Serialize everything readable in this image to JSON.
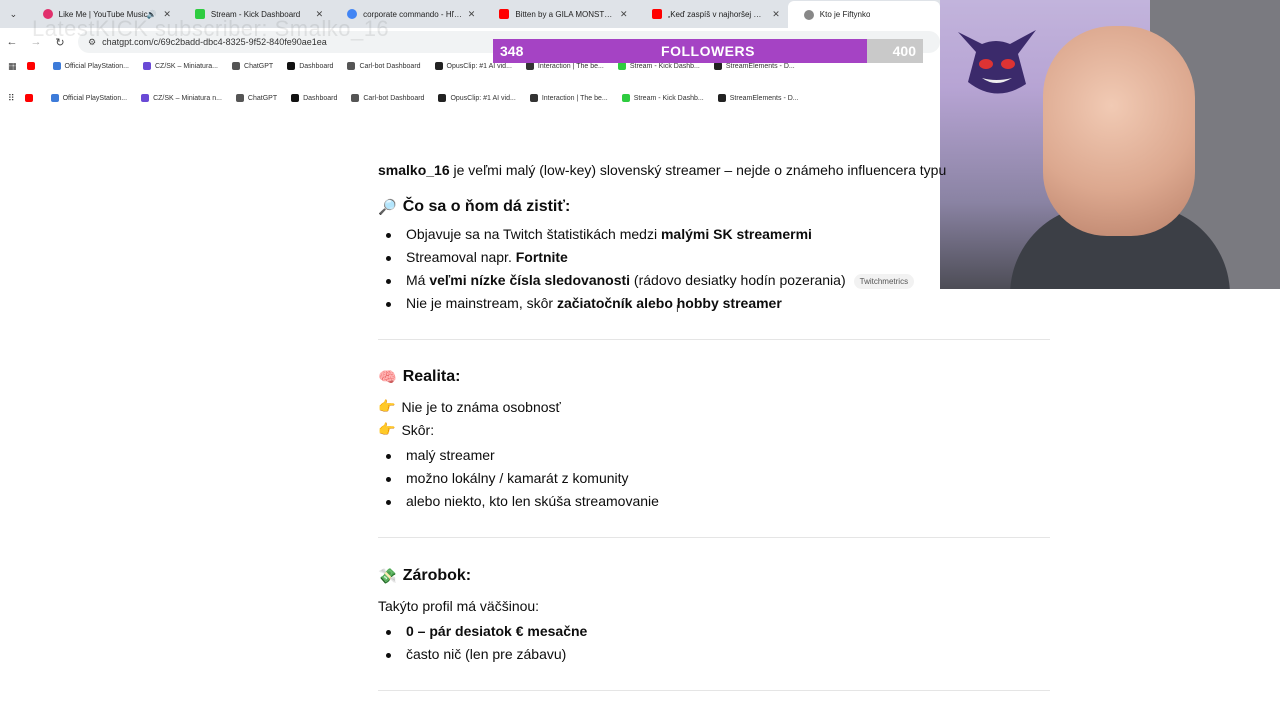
{
  "browser": {
    "tabs": [
      {
        "title": "Like Me | YouTube Music",
        "favicon_color": "#e1306c",
        "muted": true
      },
      {
        "title": "Stream - Kick Dashboard",
        "favicon_color": "#2ecc40"
      },
      {
        "title": "corporate commando - Hľadať",
        "favicon_color": "#4285f4"
      },
      {
        "title": "Bitten by a GILA MONSTER!! -",
        "favicon_color": "#ff0000"
      },
      {
        "title": "„Keď zaspíš v najhoršej možnej",
        "favicon_color": "#ff0000"
      },
      {
        "title": "Kto je Fiftynko",
        "favicon_color": "#888888",
        "active": true
      }
    ],
    "url": "chatgpt.com/c/69c2badd-dbc4-8325-9f52-840fe90ae1ea",
    "ghost_overlay_text": "LatestKICK subscriber: Smalko_16",
    "bookmarks_row1": [
      {
        "label": "",
        "color": "#ff0000"
      },
      {
        "label": "Official PlayStation...",
        "color": "#3d7bd9"
      },
      {
        "label": "CZ/SK – Miniatura...",
        "color": "#6a4ad6"
      },
      {
        "label": "ChatGPT",
        "color": "#555555"
      },
      {
        "label": "Dashboard",
        "color": "#111111"
      },
      {
        "label": "Carl-bot Dashboard",
        "color": "#555555"
      },
      {
        "label": "OpusClip: #1 AI vid...",
        "color": "#222222"
      },
      {
        "label": "Interaction | The be...",
        "color": "#333333"
      },
      {
        "label": "Stream - Kick Dashb...",
        "color": "#2ecc40"
      },
      {
        "label": "StreamElements - D...",
        "color": "#222222"
      }
    ],
    "bookmarks_row2": [
      {
        "label": "",
        "color": "#ff0000"
      },
      {
        "label": "Official PlayStation...",
        "color": "#3d7bd9"
      },
      {
        "label": "CZ/SK – Miniatura n...",
        "color": "#6a4ad6"
      },
      {
        "label": "ChatGPT",
        "color": "#555555"
      },
      {
        "label": "Dashboard",
        "color": "#111111"
      },
      {
        "label": "Carl-bot Dashboard",
        "color": "#555555"
      },
      {
        "label": "OpusClip: #1 AI vid...",
        "color": "#222222"
      },
      {
        "label": "Interaction | The be...",
        "color": "#333333"
      },
      {
        "label": "Stream - Kick Dashb...",
        "color": "#2ecc40"
      },
      {
        "label": "StreamElements - D...",
        "color": "#222222"
      }
    ]
  },
  "overlay": {
    "followers_current": "348",
    "followers_label": "FOLLOWERS",
    "followers_goal": "400",
    "followers_fill_fraction": 0.87,
    "bar_color": "#a543c4"
  },
  "article": {
    "intro": {
      "name": "smalko_16",
      "rest": " je veľmi malý (low-key) slovenský streamer – nejde o známeho influencera typu"
    },
    "section1": {
      "emoji": "🔎",
      "title": "Čo sa o ňom dá zistiť:",
      "items": [
        {
          "pre": "Objavuje sa na Twitch štatistikách medzi ",
          "bold": "malými SK streamermi",
          "post": ""
        },
        {
          "pre": "Streamoval napr. ",
          "bold": "Fortnite",
          "post": ""
        },
        {
          "pre": "Má ",
          "bold": "veľmi nízke čísla sledovanosti",
          "post": " (rádovo desiatky hodín pozerania)",
          "badge": "Twitchmetrics"
        },
        {
          "pre": "Nie je mainstream, skôr ",
          "bold": "začiatočník alebo hobby streamer",
          "post": ""
        }
      ]
    },
    "section2": {
      "emoji": "🧠",
      "title": "Realita:",
      "line1_emoji": "👉",
      "line1": "Nie je to známa osobnosť",
      "line2_emoji": "👉",
      "line2": "Skôr:",
      "items": [
        "malý streamer",
        "možno lokálny / kamarát z komunity",
        "alebo niekto, kto len skúša streamovanie"
      ]
    },
    "section3": {
      "emoji": "💸",
      "title": "Zárobok:",
      "lead": "Takýto profil má väčšinou:",
      "items": [
        {
          "bold": "0 – pár desiatok € mesačne",
          "post": ""
        },
        {
          "bold": "",
          "post": "často nič (len pre zábavu)"
        }
      ]
    }
  }
}
